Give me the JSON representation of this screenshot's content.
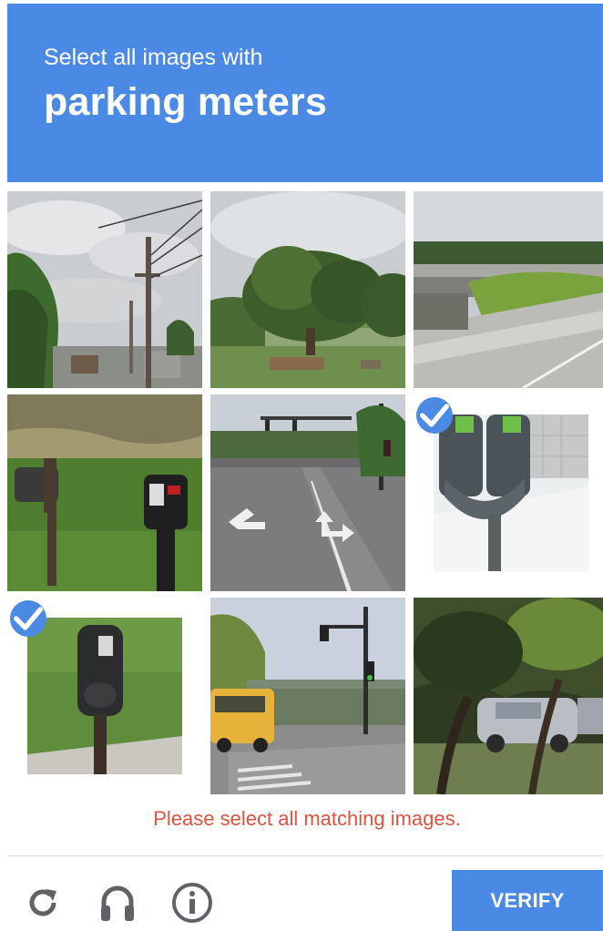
{
  "header": {
    "subtitle": "Select all images with",
    "target": "parking meters",
    "color": "#4a8ae4"
  },
  "tiles": [
    {
      "scene": "utility-poles-sky",
      "selected": false
    },
    {
      "scene": "tree-park",
      "selected": false
    },
    {
      "scene": "highway-overpass",
      "selected": false
    },
    {
      "scene": "mailboxes-grass",
      "selected": false
    },
    {
      "scene": "street-intersection",
      "selected": false
    },
    {
      "scene": "double-parking-meter",
      "selected": true
    },
    {
      "scene": "single-parking-meter",
      "selected": true
    },
    {
      "scene": "school-bus-traffic-light",
      "selected": false
    },
    {
      "scene": "car-under-trees",
      "selected": false
    }
  ],
  "error_message": "Please select all matching images.",
  "footer": {
    "icons": [
      "reload-icon",
      "audio-icon",
      "info-icon"
    ],
    "verify_label": "VERIFY"
  },
  "colors": {
    "accent": "#4a8ae4",
    "error": "#e0533f"
  }
}
